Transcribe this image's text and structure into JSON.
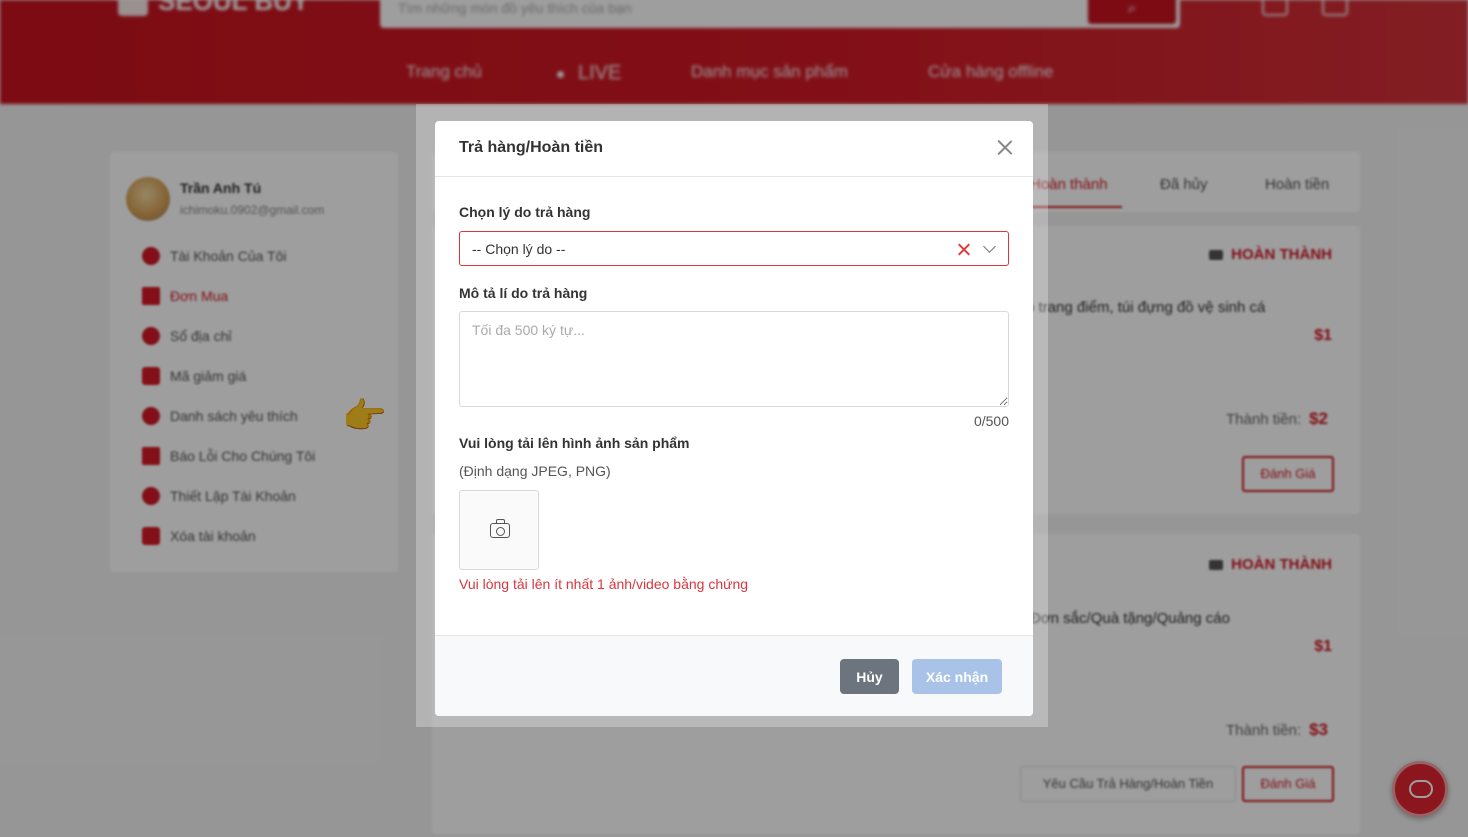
{
  "header": {
    "logo_text": "SEOUL BUY",
    "search_placeholder": "Tìm những món đồ yêu thích của bạn",
    "nav": [
      "Trang chủ",
      "LIVE",
      "Danh mục sản phẩm",
      "Cửa hàng offline"
    ]
  },
  "profile": {
    "name": "Trần Anh Tú",
    "email": "ichimoku.0902@gmail.com",
    "menu": [
      {
        "label": "Tài Khoản Của Tôi",
        "icon": "user-icon"
      },
      {
        "label": "Đơn Mua",
        "icon": "order-icon"
      },
      {
        "label": "Sổ địa chỉ",
        "icon": "location-icon"
      },
      {
        "label": "Mã giảm giá",
        "icon": "ticket-icon"
      },
      {
        "label": "Danh sách yêu thích",
        "icon": "heart-icon"
      },
      {
        "label": "Báo Lỗi Cho Chúng Tôi",
        "icon": "warning-icon"
      },
      {
        "label": "Thiết Lập Tài Khoản",
        "icon": "settings-icon"
      },
      {
        "label": "Xóa tài khoản",
        "icon": "trash-icon"
      }
    ]
  },
  "orders": {
    "tabs": [
      "Hoàn thành",
      "Đã hủy",
      "Hoàn tiền"
    ],
    "cards": [
      {
        "status": "HOÀN THÀNH",
        "product": "ô trang điểm, túi đựng đồ vệ sinh cá",
        "price": "$1",
        "total_label": "Thành tiền:",
        "total": "$2",
        "rate_label": "Đánh Giá"
      },
      {
        "status": "HOÀN THÀNH",
        "product": "Đơn sắc/Quà tặng/Quảng cáo",
        "price": "$1",
        "total_label": "Thành tiền:",
        "total": "$3",
        "rate_label": "Đánh Giá",
        "return_label": "Yêu Cầu Trả Hàng/Hoàn Tiền"
      }
    ]
  },
  "modal": {
    "title": "Trả hàng/Hoàn tiền",
    "reason_label": "Chọn lý do trả hàng",
    "reason_value": "-- Chọn lý do --",
    "desc_label": "Mô tả lí do trả hàng",
    "desc_placeholder": "Tối đa 500 ký tự...",
    "char_count": "0/500",
    "upload_label": "Vui lòng tải lên hình ảnh sản phẩm",
    "format_note": "(Định dạng JPEG, PNG)",
    "error": "Vui lòng tải lên ít nhất 1 ảnh/video bằng chứng",
    "cancel": "Hủy",
    "confirm": "Xác nhận"
  },
  "colors": {
    "brand": "#c8131f",
    "error": "#d9363e",
    "confirm_disabled": "#a9c3e8",
    "cancel": "#6c757d"
  }
}
